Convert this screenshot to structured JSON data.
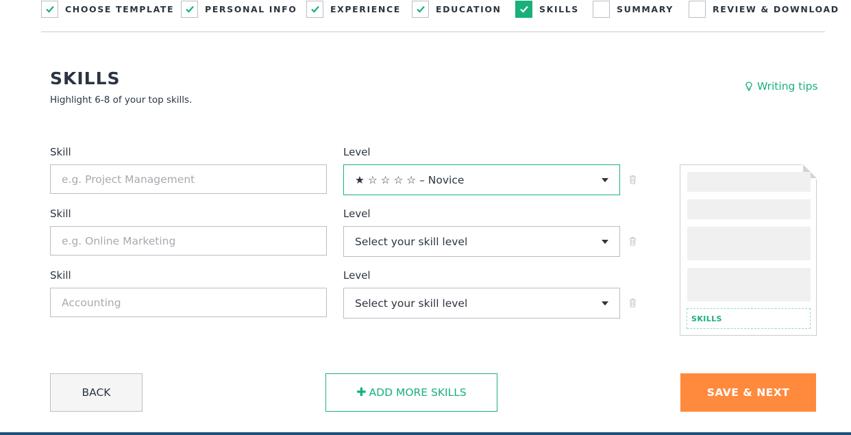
{
  "steps": [
    {
      "label": "CHOOSE TEMPLATE",
      "state": "done"
    },
    {
      "label": "PERSONAL INFO",
      "state": "done"
    },
    {
      "label": "EXPERIENCE",
      "state": "done"
    },
    {
      "label": "EDUCATION",
      "state": "done"
    },
    {
      "label": "SKILLS",
      "state": "active"
    },
    {
      "label": "SUMMARY",
      "state": "todo"
    },
    {
      "label": "REVIEW & DOWNLOAD",
      "state": "todo"
    }
  ],
  "header": {
    "title": "SKILLS",
    "subtitle": "Highlight 6-8 of your top skills.",
    "tips_label": "Writing tips",
    "tips_icon": "lightbulb-icon"
  },
  "skills": [
    {
      "skill_label": "Skill",
      "skill_placeholder": "e.g. Project Management",
      "skill_value": "",
      "level_label": "Level",
      "level_value": "★ ☆ ☆ ☆ ☆ – Novice",
      "focused": true
    },
    {
      "skill_label": "Skill",
      "skill_placeholder": "e.g. Online Marketing",
      "skill_value": "",
      "level_label": "Level",
      "level_value": "Select your skill level",
      "focused": false
    },
    {
      "skill_label": "Skill",
      "skill_placeholder": "Accounting",
      "skill_value": "",
      "level_label": "Level",
      "level_value": "Select your skill level",
      "focused": false
    }
  ],
  "preview": {
    "section_label": "SKILLS"
  },
  "buttons": {
    "back": "BACK",
    "add_more_plus": "✚",
    "add_more": "ADD MORE SKILLS",
    "save_next": "SAVE & NEXT"
  },
  "colors": {
    "accent": "#19b07c",
    "primary_button": "#ff8a3d",
    "text": "#2b3440"
  }
}
